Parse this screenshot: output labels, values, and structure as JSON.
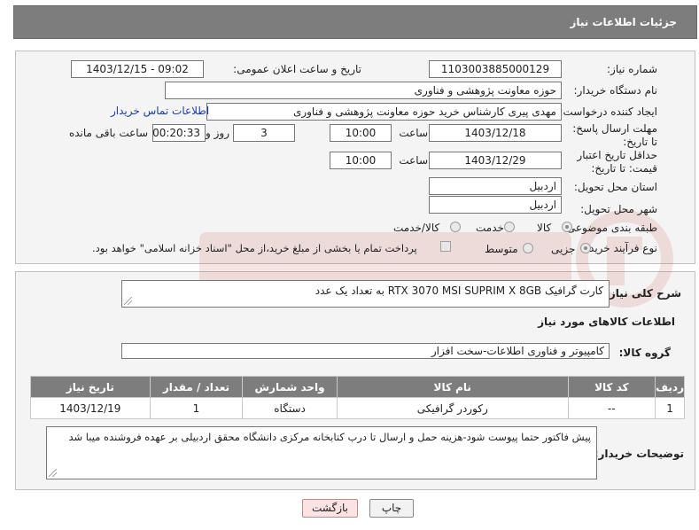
{
  "header": {
    "title": "جزئیات اطلاعات نیاز"
  },
  "form": {
    "need_number_label": "شماره نیاز:",
    "need_number": "1103003885000129",
    "announce_label": "تاریخ و ساعت اعلان عمومی:",
    "announce_value": "1403/12/15 - 09:02",
    "buyer_org_label": "نام دستگاه خریدار:",
    "buyer_org": "حوزه معاونت پژوهشی و فناوری",
    "creator_label": "ایجاد کننده درخواست:",
    "creator": "مهدی پیری کارشناس خرید حوزه معاونت پژوهشی و فناوری",
    "contact_link": "اطلاعات تماس خریدار",
    "deadline_label": "مهلت ارسال پاسخ: تا تاریخ:",
    "deadline_date": "1403/12/18",
    "time_label": "ساعت",
    "deadline_time": "10:00",
    "days_count": "3",
    "days_label": "روز و",
    "remaining_time": "00:20:33",
    "remaining_label": "ساعت باقی مانده",
    "validity_label": "حداقل تاریخ اعتبار قیمت: تا تاریخ:",
    "validity_date": "1403/12/29",
    "validity_time": "10:00",
    "province_label": "استان محل تحویل:",
    "province": "اردبیل",
    "city_label": "شهر محل تحویل:",
    "city": "اردبیل",
    "category_label": "طبقه بندی موضوعی:",
    "category_options": [
      "کالا",
      "خدمت",
      "کالا/خدمت"
    ],
    "process_label": "نوع فرآیند خرید :",
    "process_options": [
      "جزیی",
      "متوسط"
    ],
    "payment_note": "پرداخت تمام یا بخشی از مبلغ خرید،از محل \"اسناد خزانه اسلامی\" خواهد بود."
  },
  "details": {
    "description_label": "شرح کلی نیاز:",
    "description": "کارت گرافیک RTX 3070 MSI SUPRIM X 8GB به تعداد یک عدد",
    "goods_info_title": "اطلاعات کالاهای مورد نیاز",
    "goods_group_label": "گروه کالا:",
    "goods_group": "کامپیوتر و فناوری اطلاعات-سخت افزار",
    "table": {
      "headers": [
        "ردیف",
        "کد کالا",
        "نام کالا",
        "واحد شمارش",
        "تعداد / مقدار",
        "تاریخ نیاز"
      ],
      "rows": [
        [
          "1",
          "--",
          "رکوردر گرافیکی",
          "دستگاه",
          "1",
          "1403/12/19"
        ]
      ]
    },
    "buyer_notes_label": "توضیحات خریدار:",
    "buyer_notes": "پیش فاکتور حتما پیوست شود-هزینه حمل و ارسال تا درب کتابخانه مرکزی دانشگاه محقق اردبیلی بر عهده فروشنده میبا شد"
  },
  "buttons": {
    "print": "چاپ",
    "back": "بازگشت"
  },
  "colors": {
    "header_bg": "#7d7d7d",
    "link": "#1a3fa8",
    "back_button_bg": "#fbe3e3"
  }
}
